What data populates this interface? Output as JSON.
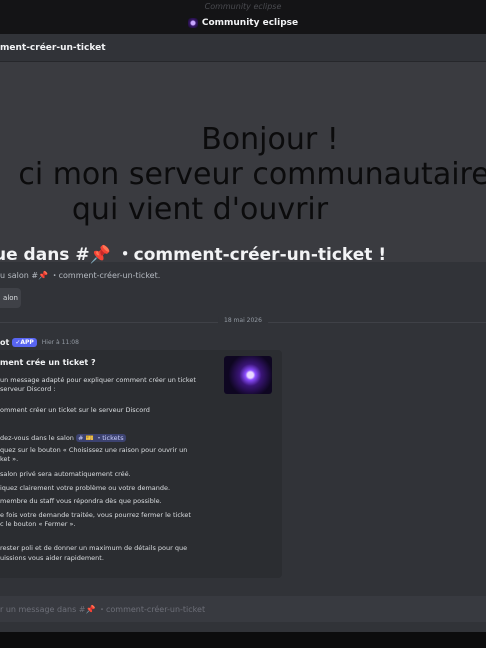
{
  "topbar": {
    "ghost": "Community eclipse",
    "title": "Community eclipse"
  },
  "channel": {
    "name": "ment-créer-un-ticket"
  },
  "welcome_image": {
    "line1": "Bonjour !",
    "line2": "ci mon serveur communautaire",
    "line3": "qui vient d'ouvrir"
  },
  "welcome": {
    "heading": "ue dans #📌 ・comment-créer-un-ticket !",
    "sub": "u salon #📌 ・comment-créer-un-ticket.",
    "edit_chip": "alon"
  },
  "date_divider": "18 mai 2026",
  "message": {
    "author": "ot",
    "badge": "✓APP",
    "time": "Hier à 11:08"
  },
  "embed": {
    "title": "ment crée un ticket ?",
    "lines": [
      "un message adapté pour expliquer comment créer un ticket",
      "serveur Discord :",
      "",
      "omment créer un ticket sur le serveur Discord",
      "",
      "dez-vous dans le salon",
      "quez sur le bouton « Choisissez une raison pour ouvrir un",
      "ket ».",
      "salon privé sera automatiquement créé.",
      "iquez clairement votre problème ou votre demande.",
      "membre du staff vous répondra dès que possible.",
      "e fois votre demande traitée, vous pourrez fermer le ticket",
      "c le bouton « Fermer ».",
      "",
      "rester poli et de donner un maximum de détails pour que",
      "uissions vous aider rapidement."
    ],
    "mention": "# 🎫 ・tickets"
  },
  "input": {
    "placeholder": "r un message dans #📌 ・comment-créer-un-ticket"
  }
}
